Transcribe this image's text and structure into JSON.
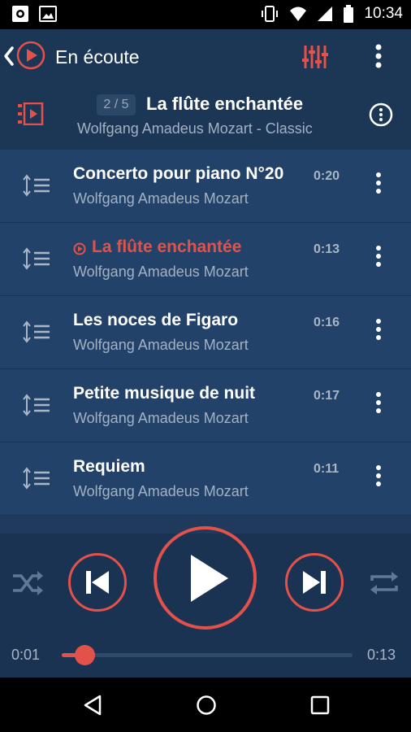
{
  "status_bar": {
    "time": "10:34"
  },
  "toolbar": {
    "title": "En écoute"
  },
  "now_playing": {
    "index": "2 / 5",
    "title": "La flûte enchantée",
    "subtitle": "Wolfgang Amadeus Mozart - Classic"
  },
  "queue": [
    {
      "title": "Concerto pour piano N°20",
      "artist": "Wolfgang Amadeus Mozart",
      "duration": "0:20",
      "playing": false
    },
    {
      "title": "La flûte enchantée",
      "artist": "Wolfgang Amadeus Mozart",
      "duration": "0:13",
      "playing": true
    },
    {
      "title": "Les noces de Figaro",
      "artist": "Wolfgang Amadeus Mozart",
      "duration": "0:16",
      "playing": false
    },
    {
      "title": "Petite musique de nuit",
      "artist": "Wolfgang Amadeus Mozart",
      "duration": "0:17",
      "playing": false
    },
    {
      "title": "Requiem",
      "artist": "Wolfgang Amadeus Mozart",
      "duration": "0:11",
      "playing": false
    }
  ],
  "player": {
    "elapsed": "0:01",
    "total": "0:13",
    "progress": 0.077
  },
  "colors": {
    "accent": "#e2524a",
    "background": "#1f3a5c",
    "row": "#23426a"
  },
  "icons": [
    "back-chevron-icon",
    "app-logo-icon",
    "equalizer-icon",
    "overflow-menu-icon",
    "queue-icon",
    "info-icon",
    "drag-handle-icon",
    "shuffle-icon",
    "previous-icon",
    "play-icon",
    "next-icon",
    "repeat-icon"
  ]
}
